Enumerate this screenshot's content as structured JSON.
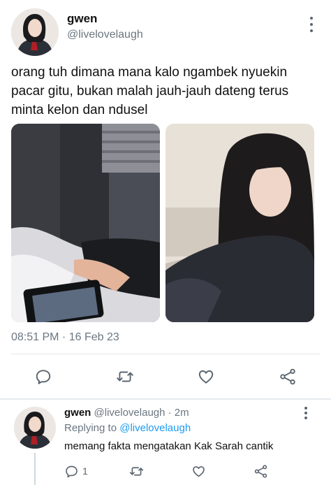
{
  "tweet": {
    "name": "gwen",
    "handle": "@livelovelaugh",
    "text": "orang tuh dimana mana kalo ngambek nyuekin pacar gitu, bukan malah jauh-jauh dateng terus minta kelon dan ndusel",
    "timestamp": "08:51 PM · 16 Feb 23",
    "photos": [
      {
        "description": "person lying in bed holding a tablet"
      },
      {
        "description": "young woman with long dark hair in black sweater"
      }
    ]
  },
  "actions": {
    "reply_icon": "comment-icon",
    "retweet_icon": "retweet-icon",
    "like_icon": "heart-icon",
    "share_icon": "share-icon"
  },
  "reply": {
    "name": "gwen",
    "meta": "@livelovelaugh · 2m",
    "replying_prefix": "Replying to",
    "replying_to": "@livelovelaugh",
    "text": "memang fakta mengatakan Kak Sarah cantik",
    "reply_count": "1"
  },
  "colors": {
    "accent": "#1d9bf0",
    "icon": "#5c6670",
    "secondary_text": "#6b7680"
  }
}
